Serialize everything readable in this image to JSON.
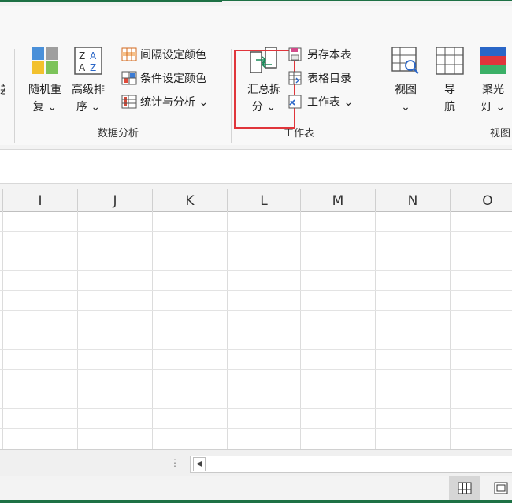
{
  "ribbon": {
    "groups": {
      "data_analysis": "数据分析",
      "worksheet": "工作表",
      "view": "视图"
    },
    "buttons": {
      "random_repeat": [
        "随机重",
        "复 ⌄"
      ],
      "advanced_sort": [
        "高级排",
        "序 ⌄"
      ],
      "interval_color": "间隔设定颜色",
      "condition_color": "条件设定颜色",
      "stats_analysis": "统计与分析 ⌄",
      "summary_split": [
        "汇总拆",
        "分 ⌄"
      ],
      "save_sheet": "另存本表",
      "table_directory": "表格目录",
      "worksheet": "工作表 ⌄",
      "view_btn": [
        "视图",
        "⌄"
      ],
      "navigate": [
        "导",
        "航"
      ],
      "spotlight": [
        "聚光",
        "灯 ⌄"
      ]
    }
  },
  "sheet": {
    "columns": [
      "I",
      "J",
      "K",
      "L",
      "M",
      "N",
      "O"
    ]
  },
  "colors": {
    "accent": "#1e7145",
    "highlight": "#e0353b"
  }
}
